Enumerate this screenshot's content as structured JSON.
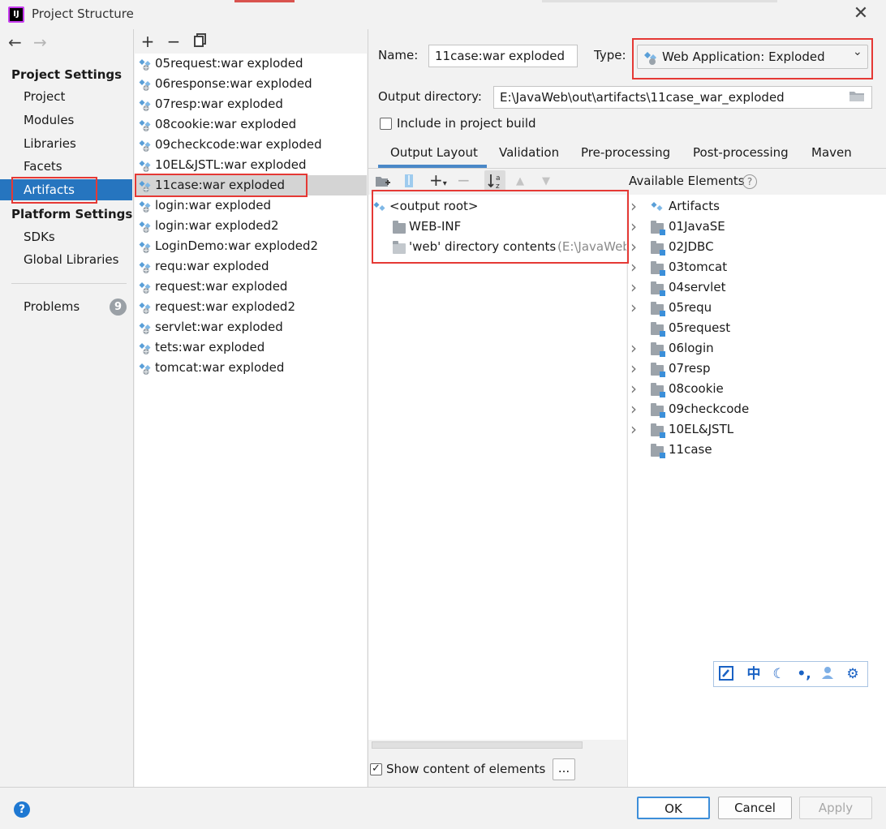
{
  "window": {
    "title": "Project Structure",
    "app_icon_text": "IJ"
  },
  "nav": {
    "back_icon": "arrow-left-icon",
    "forward_icon": "arrow-right-icon",
    "project_settings_heading": "Project Settings",
    "project_settings_items": [
      "Project",
      "Modules",
      "Libraries",
      "Facets",
      "Artifacts"
    ],
    "selected_item": "Artifacts",
    "platform_settings_heading": "Platform Settings",
    "platform_settings_items": [
      "SDKs",
      "Global Libraries"
    ],
    "problems_label": "Problems",
    "problems_count": "9"
  },
  "artifacts_toolbar": {
    "add": "+",
    "remove": "−",
    "copy_icon": "copy-icon"
  },
  "artifacts": [
    "05request:war exploded",
    "06response:war exploded",
    "07resp:war exploded",
    "08cookie:war exploded",
    "09checkcode:war exploded",
    "10EL&JSTL:war exploded",
    "11case:war exploded",
    "login:war exploded",
    "login:war exploded2",
    "LoginDemo:war exploded2",
    "requ:war exploded",
    "request:war exploded",
    "request:war exploded2",
    "servlet:war exploded",
    "tets:war exploded",
    "tomcat:war exploded"
  ],
  "selected_artifact": "11case:war exploded",
  "detail": {
    "name_label": "Name:",
    "name_value": "11case:war exploded",
    "type_label": "Type:",
    "type_value": "Web Application: Exploded",
    "output_dir_label": "Output directory:",
    "output_dir_value": "E:\\JavaWeb\\out\\artifacts\\11case_war_exploded",
    "include_label": "Include in project build",
    "include_checked": false,
    "tabs": [
      "Output Layout",
      "Validation",
      "Pre-processing",
      "Post-processing",
      "Maven"
    ],
    "active_tab": "Output Layout",
    "available_label": "Available Elements",
    "help_glyph": "?"
  },
  "layout_tree": [
    {
      "label": "<output root>",
      "kind": "artifact-root"
    },
    {
      "label": "WEB-INF",
      "kind": "folder"
    },
    {
      "label": "'web' directory contents",
      "suffix": "(E:\\JavaWeb",
      "kind": "folder-light"
    }
  ],
  "available_tree": [
    {
      "label": "Artifacts",
      "expandable": true,
      "kind": "artifact"
    },
    {
      "label": "01JavaSE",
      "expandable": true,
      "kind": "module"
    },
    {
      "label": "02JDBC",
      "expandable": true,
      "kind": "module"
    },
    {
      "label": "03tomcat",
      "expandable": true,
      "kind": "module"
    },
    {
      "label": "04servlet",
      "expandable": true,
      "kind": "module"
    },
    {
      "label": "05requ",
      "expandable": true,
      "kind": "module"
    },
    {
      "label": "05request",
      "expandable": false,
      "kind": "module"
    },
    {
      "label": "06login",
      "expandable": true,
      "kind": "module"
    },
    {
      "label": "07resp",
      "expandable": true,
      "kind": "module"
    },
    {
      "label": "08cookie",
      "expandable": true,
      "kind": "module"
    },
    {
      "label": "09checkcode",
      "expandable": true,
      "kind": "module"
    },
    {
      "label": "10EL&JSTL",
      "expandable": true,
      "kind": "module"
    },
    {
      "label": "11case",
      "expandable": false,
      "kind": "module"
    }
  ],
  "ime_toolbar": {
    "zh": "中"
  },
  "footer": {
    "show_content_label": "Show content of elements",
    "show_content_checked": true,
    "more_button": "...",
    "ok": "OK",
    "cancel": "Cancel",
    "apply": "Apply",
    "help": "?"
  },
  "colors": {
    "selection": "#2675bf",
    "annotation": "#e53935",
    "tab_underline": "#4a88c7"
  }
}
